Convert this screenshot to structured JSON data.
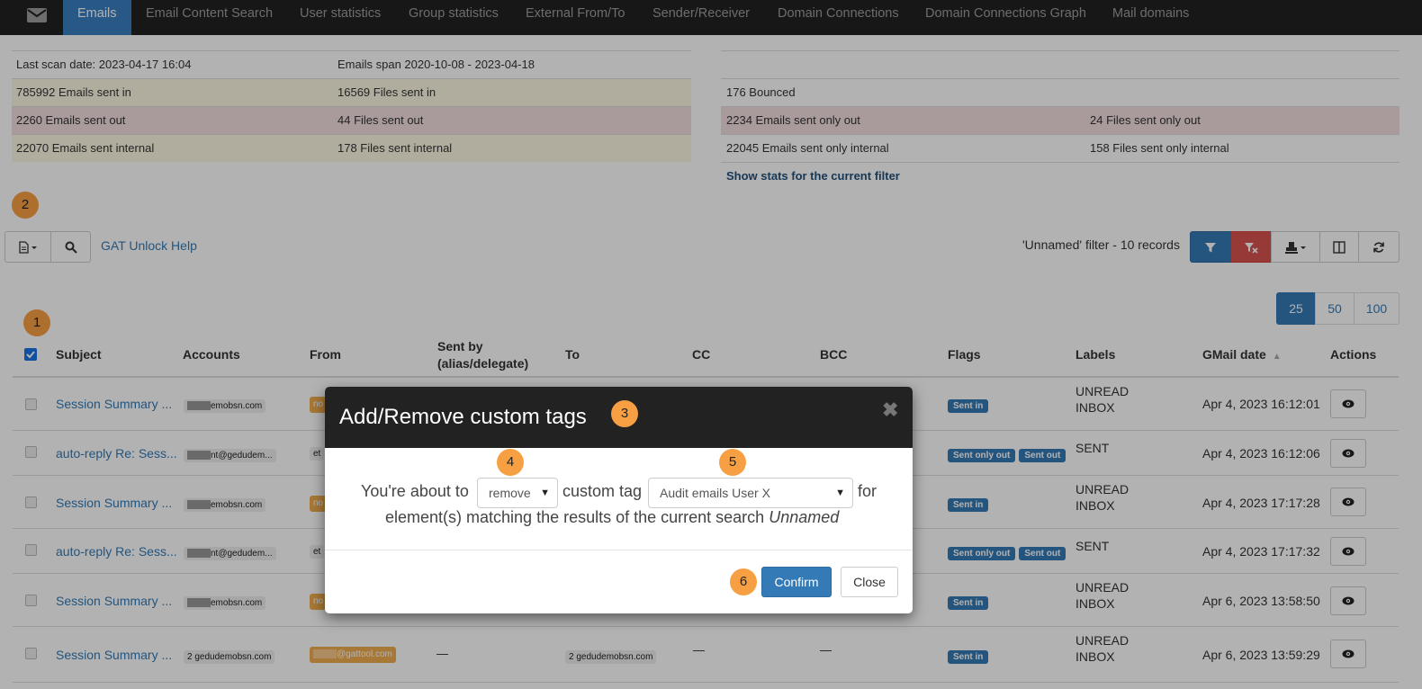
{
  "nav": {
    "tabs": [
      "Emails",
      "Email Content Search",
      "User statistics",
      "Group statistics",
      "External From/To",
      "Sender/Receiver",
      "Domain Connections",
      "Domain Connections Graph",
      "Mail domains"
    ]
  },
  "stats": {
    "last_scan": "Last scan date: 2023-04-17 16:04",
    "emails_span": "Emails span 2020-10-08 - 2023-04-18",
    "emails_sent_in": "785992 Emails sent in",
    "files_sent_in": "16569 Files sent in",
    "emails_sent_out": "2260 Emails sent out",
    "files_sent_out": "44 Files sent out",
    "emails_internal": "22070 Emails sent internal",
    "files_internal": "178 Files sent internal",
    "bounced": "176 Bounced",
    "emails_only_out": "2234 Emails sent only out",
    "files_only_out": "24 Files sent only out",
    "emails_only_internal": "22045 Emails sent only internal",
    "files_only_internal": "158 Files sent only internal",
    "show_stats": "Show stats for the current filter"
  },
  "markers": [
    "1",
    "2",
    "3",
    "4",
    "5",
    "6"
  ],
  "toolbar": {
    "help": "GAT Unlock Help",
    "filter_info": "'Unnamed' filter -  10 records"
  },
  "pagination": [
    "25",
    "50",
    "100"
  ],
  "table": {
    "headers": [
      "Subject",
      "Accounts",
      "From",
      "Sent by",
      "(alias/delegate)",
      "To",
      "CC",
      "BCC",
      "Flags",
      "Labels",
      "GMail date",
      "Actions"
    ],
    "rows": [
      {
        "subject": "Session Summary ...",
        "account": "emobsn.com",
        "from": "no",
        "flags": [
          "Sent in"
        ],
        "labels": [
          "UNREAD",
          "INBOX"
        ],
        "date": "Apr 4, 2023 16:12:01"
      },
      {
        "subject": "auto-reply Re: Sess...",
        "account": "nt@gedudem...",
        "from": "et",
        "flags": [
          "Sent only out",
          "Sent out"
        ],
        "labels": [
          "SENT"
        ],
        "date": "Apr 4, 2023 16:12:06"
      },
      {
        "subject": "Session Summary ...",
        "account": "emobsn.com",
        "from": "no",
        "flags": [
          "Sent in"
        ],
        "labels": [
          "UNREAD",
          "INBOX"
        ],
        "date": "Apr 4, 2023 17:17:28"
      },
      {
        "subject": "auto-reply Re: Sess...",
        "account": "nt@gedudem...",
        "from": "et",
        "flags": [
          "Sent only out",
          "Sent out"
        ],
        "labels": [
          "SENT"
        ],
        "date": "Apr 4, 2023 17:17:32"
      },
      {
        "subject": "Session Summary ...",
        "account": "emobsn.com",
        "from": "no",
        "flags": [
          "Sent in"
        ],
        "labels": [
          "UNREAD",
          "INBOX"
        ],
        "date": "Apr 6, 2023 13:58:50"
      },
      {
        "subject": "Session Summary ...",
        "account": "2 gedudemobsn.com",
        "from": "@gattool.com",
        "sent_by": "—",
        "to": "2 gedudemobsn.com",
        "cc": "—",
        "bcc": "—",
        "flags": [
          "Sent in"
        ],
        "labels": [
          "UNREAD",
          "INBOX"
        ],
        "date": "Apr 6, 2023 13:59:29"
      }
    ]
  },
  "modal": {
    "title": "Add/Remove custom tags",
    "close_x": "✖",
    "text_before": "You're about to",
    "action_value": "remove",
    "text_middle": "custom tag",
    "tag_value": "Audit emails User X",
    "text_after": "for",
    "line2": "element(s) matching the results of the current search",
    "search_name": "Unnamed",
    "confirm": "Confirm",
    "close": "Close"
  }
}
